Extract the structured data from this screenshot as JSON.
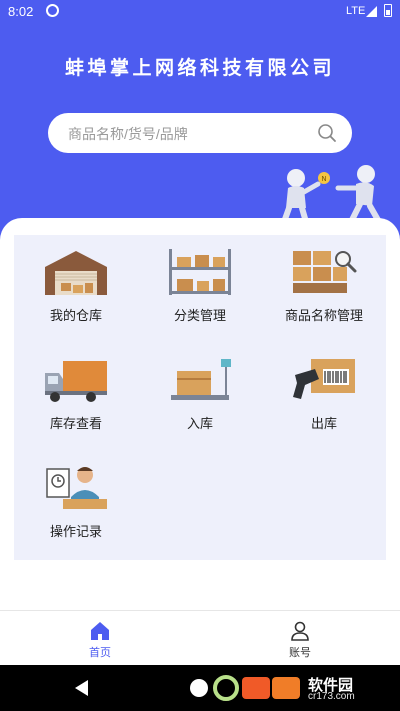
{
  "status_bar": {
    "time": "8:02",
    "network": "LTE"
  },
  "header": {
    "title": "蚌埠掌上网络科技有限公司"
  },
  "search": {
    "placeholder": "商品名称/货号/品牌"
  },
  "menu": [
    {
      "label": "我的仓库",
      "icon": "warehouse-icon"
    },
    {
      "label": "分类管理",
      "icon": "shelf-icon"
    },
    {
      "label": "商品名称管理",
      "icon": "goods-search-icon"
    },
    {
      "label": "库存查看",
      "icon": "truck-icon"
    },
    {
      "label": "入库",
      "icon": "scale-icon"
    },
    {
      "label": "出库",
      "icon": "scanner-icon"
    },
    {
      "label": "操作记录",
      "icon": "worker-record-icon"
    }
  ],
  "tabbar": {
    "home": {
      "label": "首页",
      "icon": "home-icon"
    },
    "account": {
      "label": "账号",
      "icon": "user-icon"
    }
  },
  "watermark": {
    "text": "软件园",
    "domain": "cr173.com"
  },
  "colors": {
    "primary": "#4d5cf0",
    "panel": "#eef0fb",
    "tab_active": "#4d5cf0",
    "tab_inactive": "#333333"
  }
}
